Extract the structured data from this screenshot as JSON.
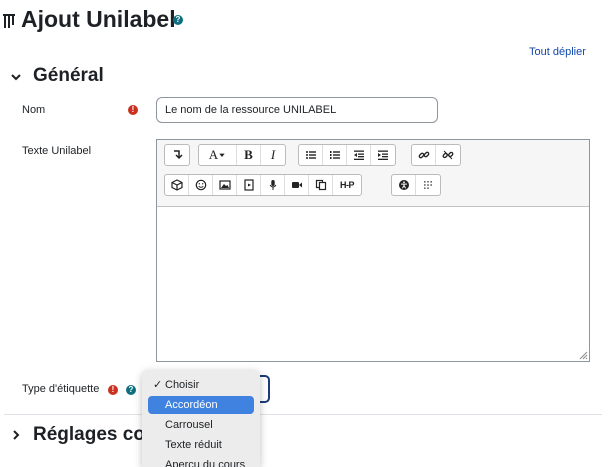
{
  "page": {
    "title": "Ajout Unilabel",
    "title_help_icon": "question-circle-icon",
    "expand_all": "Tout déplier"
  },
  "sections": [
    {
      "title": "Général",
      "state": "expanded",
      "icon": "chevron-down-icon"
    },
    {
      "title": "Réglages co",
      "state": "collapsed",
      "icon": "chevron-right-icon"
    }
  ],
  "form": {
    "name_label": "Nom",
    "name_value": "Le nom de la ressource UNILABEL",
    "text_label": "Texte Unilabel",
    "type_label": "Type d'étiquette",
    "required_icon": "exclamation-circle-icon",
    "help_icon": "question-circle-icon"
  },
  "editor": {
    "toolbar_row1": [
      "expand-toolbar-icon",
      "font-color-icon",
      "bold-icon",
      "italic-icon",
      "bullet-list-icon",
      "numbered-list-icon",
      "outdent-icon",
      "indent-icon",
      "link-icon",
      "unlink-icon"
    ],
    "toolbar_row2": [
      "cube-icon",
      "emoji-icon",
      "image-icon",
      "media-icon",
      "microphone-icon",
      "video-camera-icon",
      "copy-icon",
      "h5p-icon",
      "accessibility-icon",
      "equation-icon"
    ],
    "font_glyph": "A",
    "bold_glyph": "B",
    "italic_glyph": "I",
    "h5p_glyph": "H-P"
  },
  "dropdown": {
    "selected_mark": "✓",
    "options": [
      "Choisir",
      "Accordéon",
      "Carrousel",
      "Texte réduit",
      "Aperçu du cours"
    ],
    "checked_index": 0,
    "highlighted_index": 1
  },
  "colors": {
    "accent_blue": "#0f47ad",
    "help_teal": "#0f6f7f",
    "required_red": "#ca3120",
    "highlight": "#3f82e0",
    "select_border": "#1d3a7a"
  }
}
